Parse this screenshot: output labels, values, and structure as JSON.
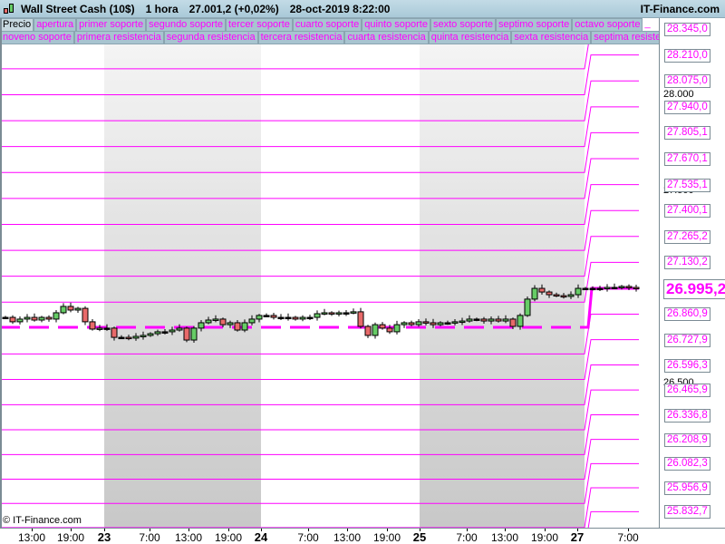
{
  "header": {
    "title": "Wall Street Cash (10$)",
    "timeframe": "1 hora",
    "price": "27.001,2 (+0,02%)",
    "datetime": "28-oct-2019 8:22:00",
    "brand": "IT-Finance.com",
    "icon": "candlestick-icon"
  },
  "legend_row1": [
    "Precio",
    "apertura",
    "primer soporte",
    "segundo soporte",
    "tercer soporte",
    "cuarto soporte",
    "quinto soporte",
    "sexto soporte",
    "septimo soporte",
    "octavo soporte",
    "_"
  ],
  "legend_row2": [
    "noveno soporte",
    "primera resistencia",
    "segunda resistencia",
    "tercera resistencia",
    "cuarta resistencia",
    "quinta resistencia",
    "sexta resistencia",
    "septima resistencia"
  ],
  "colors": {
    "level": "#ff00ff",
    "up": "#66cc66",
    "down": "#e86a6a",
    "shade_top": "#f2f2f2",
    "shade_bottom": "#c8c8c8"
  },
  "price_axis": {
    "levels": [
      "28.345,0",
      "28.210,0",
      "28.075,0",
      "27.940,0",
      "27.805,1",
      "27.670,1",
      "27.535,1",
      "27.400,1",
      "27.265,2",
      "27.130,2",
      "26.995,2",
      "26.860,9",
      "26.727,9",
      "26.596,3",
      "26.465,9",
      "26.336,8",
      "26.208,9",
      "26.082,3",
      "25.956,9",
      "25.832,7"
    ],
    "current_index": 10,
    "ticks": [
      "28.000",
      "27.500",
      "26.500"
    ],
    "range": [
      25760,
      28420
    ]
  },
  "levels_prev_shift": -207,
  "apertura_prev": 26792,
  "time_axis": [
    "13:00",
    "19:00",
    "23",
    "7:00",
    "13:00",
    "19:00",
    "24",
    "7:00",
    "13:00",
    "19:00",
    "25",
    "7:00",
    "13:00",
    "19:00",
    "27",
    "7:00"
  ],
  "copyright": "© IT-Finance.com",
  "closes": [
    26844,
    26821,
    26835,
    26844,
    26830,
    26844,
    26835,
    26868,
    26901,
    26882,
    26891,
    26821,
    26783,
    26788,
    26788,
    26740,
    26740,
    26736,
    26745,
    26750,
    26759,
    26769,
    26769,
    26778,
    26788,
    26726,
    26788,
    26816,
    26830,
    26835,
    26806,
    26816,
    26778,
    26816,
    26835,
    26854,
    26854,
    26844,
    26844,
    26844,
    26835,
    26844,
    26844,
    26863,
    26868,
    26863,
    26868,
    26868,
    26873,
    26797,
    26750,
    26806,
    26788,
    26769,
    26806,
    26816,
    26806,
    26821,
    26816,
    26806,
    26816,
    26816,
    26821,
    26825,
    26835,
    26835,
    26825,
    26835,
    26825,
    26835,
    26797,
    26854,
    26939,
    26995,
    26976,
    26962,
    26957,
    26953,
    26962,
    26995,
    26995,
    26995,
    26995,
    27000,
    27000,
    27005,
    27000,
    26995
  ]
}
